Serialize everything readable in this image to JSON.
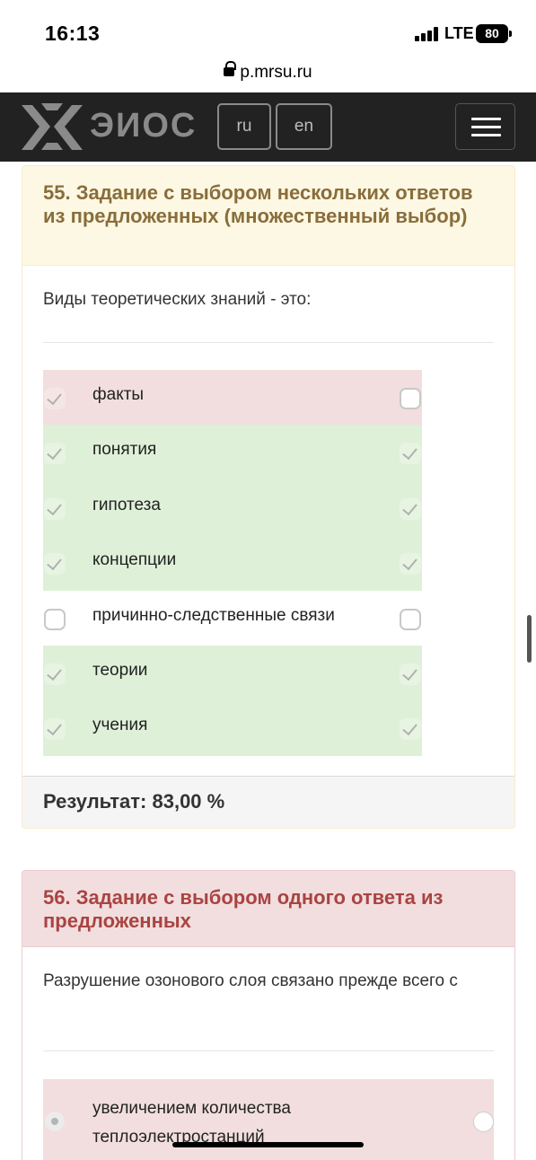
{
  "status_bar": {
    "time": "16:13",
    "network": "LTE",
    "battery": "80"
  },
  "browser": {
    "url": "p.mrsu.ru"
  },
  "navbar": {
    "logo_text": "ЭИОС",
    "lang_ru": "ru",
    "lang_en": "en",
    "menu_icon": "hamburger-icon"
  },
  "question55": {
    "title": "55. Задание с выбором нескольких ответов из предложенных (множественный выбор)",
    "text": "Виды теоретических знаний - это:",
    "options": [
      {
        "label": "факты",
        "status": "incorrect",
        "user_checked": true,
        "correct_checked": false
      },
      {
        "label": "понятия",
        "status": "correct",
        "user_checked": true,
        "correct_checked": true
      },
      {
        "label": "гипотеза",
        "status": "correct",
        "user_checked": true,
        "correct_checked": true
      },
      {
        "label": "концепции",
        "status": "correct",
        "user_checked": true,
        "correct_checked": true
      },
      {
        "label": "причинно-следственные связи",
        "status": "neutral",
        "user_checked": false,
        "correct_checked": false
      },
      {
        "label": "теории",
        "status": "correct",
        "user_checked": true,
        "correct_checked": true
      },
      {
        "label": "учения",
        "status": "correct",
        "user_checked": true,
        "correct_checked": true
      }
    ],
    "result": "Результат: 83,00 %"
  },
  "question56": {
    "title": "56. Задание с выбором одного ответа из предложенных",
    "text": "Разрушение озонового слоя связано прежде всего с",
    "options": [
      {
        "label": "увеличением количества теплоэлектростанций",
        "status": "incorrect",
        "user_selected": true,
        "correct_selected": false
      }
    ]
  },
  "colors": {
    "navbar_bg": "#222222",
    "warning_header_bg": "#fcf8e3",
    "warning_title": "#8a6d3b",
    "danger_header_bg": "#f2dede",
    "danger_title": "#a94442",
    "correct_row_bg": "#dff0d8",
    "incorrect_row_bg": "#f2dede"
  }
}
